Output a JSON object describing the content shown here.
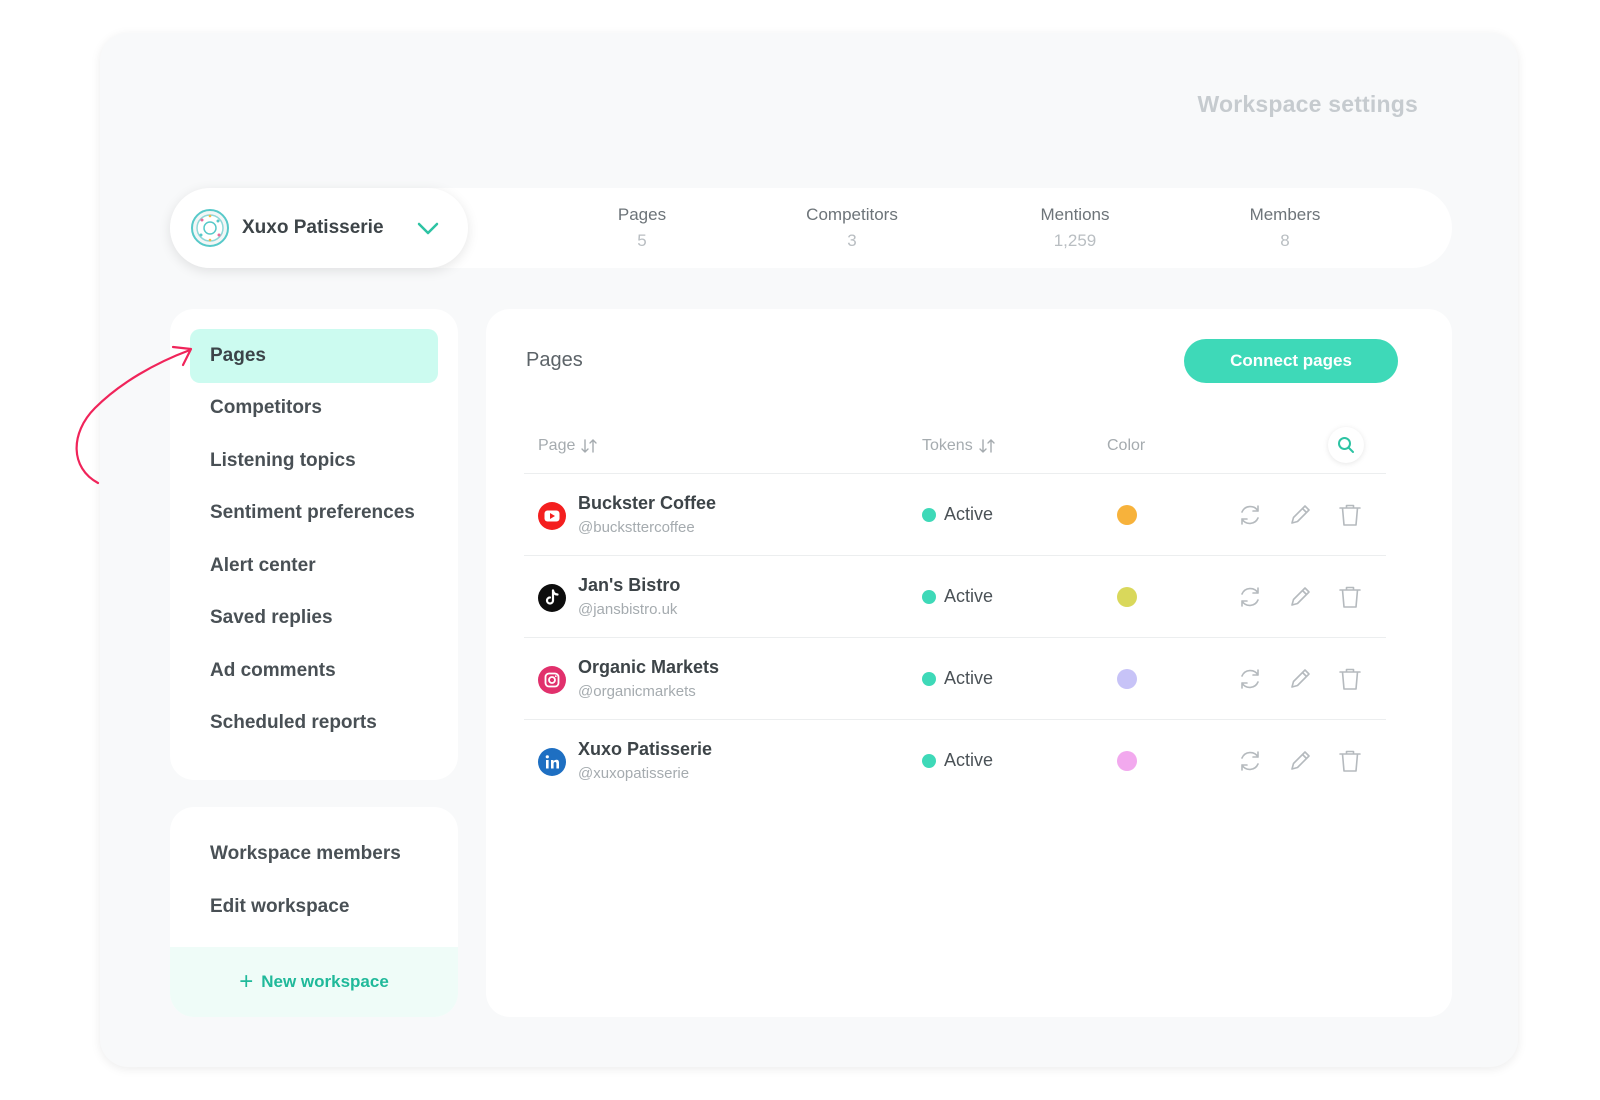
{
  "header": {
    "title": "Workspace settings"
  },
  "workspace": {
    "name": "Xuxo Patisserie"
  },
  "stats": [
    {
      "label": "Pages",
      "value": "5"
    },
    {
      "label": "Competitors",
      "value": "3"
    },
    {
      "label": "Mentions",
      "value": "1,259"
    },
    {
      "label": "Members",
      "value": "8"
    }
  ],
  "sidebar": {
    "items": [
      {
        "label": "Pages",
        "active": true
      },
      {
        "label": "Competitors"
      },
      {
        "label": "Listening topics"
      },
      {
        "label": "Sentiment preferences"
      },
      {
        "label": "Alert center"
      },
      {
        "label": "Saved replies"
      },
      {
        "label": "Ad comments"
      },
      {
        "label": "Scheduled reports"
      }
    ],
    "secondary": [
      {
        "label": "Workspace members"
      },
      {
        "label": "Edit workspace"
      }
    ],
    "new_workspace_label": "New workspace"
  },
  "main": {
    "title": "Pages",
    "connect_label": "Connect pages",
    "columns": {
      "page": "Page",
      "tokens": "Tokens",
      "color": "Color"
    },
    "rows": [
      {
        "name": "Buckster Coffee",
        "handle": "@bucksttercoffee",
        "status": "Active",
        "color": "#f7b23b",
        "platform": "youtube-icon"
      },
      {
        "name": "Jan's Bistro",
        "handle": "@jansbistro.uk",
        "status": "Active",
        "color": "#d9d85b",
        "platform": "tiktok-icon"
      },
      {
        "name": "Organic Markets",
        "handle": "@organicmarkets",
        "status": "Active",
        "color": "#c7c3f7",
        "platform": "instagram-icon"
      },
      {
        "name": "Xuxo Patisserie",
        "handle": "@xuxopatisserie",
        "status": "Active",
        "color": "#f2a9ee",
        "platform": "linkedin-icon"
      }
    ]
  },
  "colors": {
    "accent": "#3ed9b8",
    "active_nav": "#ccfbf0",
    "arrow": "#f0245a"
  }
}
